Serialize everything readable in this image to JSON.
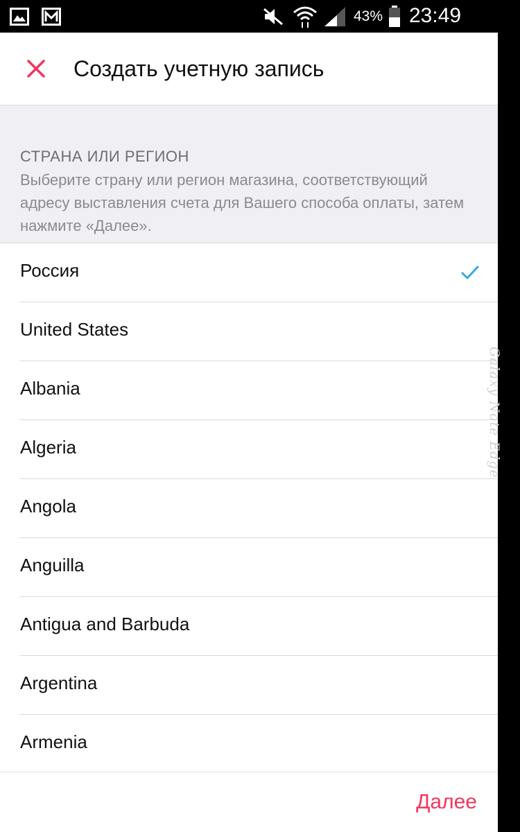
{
  "status_bar": {
    "battery_percent": "43%",
    "time": "23:49"
  },
  "device": {
    "edge_label": "Galaxy Note Edge"
  },
  "header": {
    "title": "Создать учетную запись"
  },
  "section": {
    "title": "СТРАНА ИЛИ РЕГИОН",
    "description": "Выберите страну или регион магазина, соответствующий адресу выставления счета для Вашего способа оплаты, затем нажмите «Далее»."
  },
  "countries": [
    {
      "name": "Россия",
      "selected": true
    },
    {
      "name": "United States",
      "selected": false
    },
    {
      "name": "Albania",
      "selected": false
    },
    {
      "name": "Algeria",
      "selected": false
    },
    {
      "name": "Angola",
      "selected": false
    },
    {
      "name": "Anguilla",
      "selected": false
    },
    {
      "name": "Antigua and Barbuda",
      "selected": false
    },
    {
      "name": "Argentina",
      "selected": false
    },
    {
      "name": "Armenia",
      "selected": false
    }
  ],
  "footer": {
    "next_label": "Далее"
  },
  "colors": {
    "accent_red": "#f2365d",
    "check_blue": "#35a7e0",
    "section_bg": "#efeff4"
  },
  "icons": {
    "status_left": [
      "gallery-icon",
      "mail-icon"
    ],
    "status_right": [
      "mute-icon",
      "wifi-icon",
      "signal-icon",
      "battery-icon"
    ],
    "close": "close-icon",
    "check": "check-icon"
  }
}
